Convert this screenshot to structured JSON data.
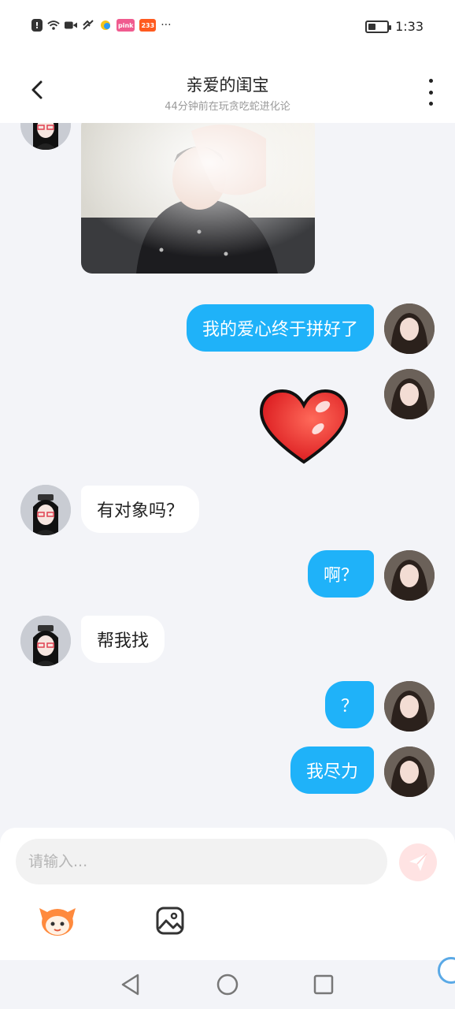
{
  "status_bar": {
    "time": "1:33",
    "badge_1": "pink",
    "badge_2": "233",
    "more": "···"
  },
  "header": {
    "title": "亲爱的闺宝",
    "subtitle": "44分钟前在玩贪吃蛇进化论"
  },
  "messages": [
    {
      "from": "other",
      "type": "image"
    },
    {
      "from": "me",
      "type": "text",
      "text": "我的爱心终于拼好了"
    },
    {
      "from": "me",
      "type": "sticker",
      "sticker": "red-heart"
    },
    {
      "from": "other",
      "type": "text",
      "text": "有对象吗？"
    },
    {
      "from": "me",
      "type": "text",
      "text": "啊？"
    },
    {
      "from": "other",
      "type": "text",
      "text": "帮我找"
    },
    {
      "from": "me",
      "type": "text",
      "text": "？"
    },
    {
      "from": "me",
      "type": "text",
      "text": "我尽力"
    }
  ],
  "input": {
    "placeholder": "请输入..."
  },
  "icons": {
    "back": "chevron-left-icon",
    "more": "more-vertical-icon",
    "send": "paper-plane-icon",
    "emoji": "mascot-emoji-icon",
    "image": "image-icon"
  },
  "colors": {
    "my_bubble": "#1fb2f9",
    "other_bubble": "#ffffff",
    "background": "#f3f4f8",
    "send_button": "#ffe3e3"
  }
}
